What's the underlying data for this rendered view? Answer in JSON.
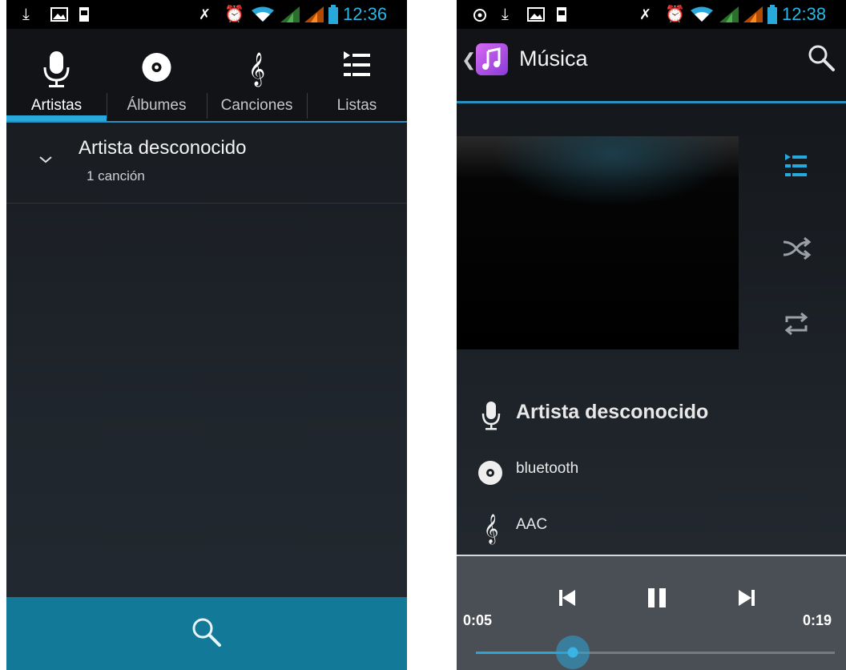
{
  "left_screen": {
    "status": {
      "time": "12:36",
      "icons": [
        "download-icon",
        "image-icon",
        "sd-icon",
        "mute-icon",
        "alarm-icon",
        "wifi-icon",
        "signal-icon",
        "signal-icon",
        "battery-icon"
      ]
    },
    "tabs": [
      {
        "label": "Artistas",
        "icon": "microphone-icon",
        "active": true
      },
      {
        "label": "Álbumes",
        "icon": "disc-icon"
      },
      {
        "label": "Canciones",
        "icon": "treble-clef-icon"
      },
      {
        "label": "Listas",
        "icon": "playlist-icon"
      }
    ],
    "artist_item": {
      "name": "Artista desconocido",
      "count": "1 canción"
    }
  },
  "right_screen": {
    "status": {
      "time": "12:38"
    },
    "title": "Música",
    "track": {
      "artist": "Artista desconocido",
      "album": "bluetooth",
      "song": "AAC"
    },
    "player": {
      "elapsed": "0:05",
      "total": "0:19",
      "progress": 0.27
    }
  },
  "colors": {
    "accent": "#29a8dc",
    "bottom_bar": "#127a98",
    "player_bg": "#4a4f55"
  }
}
